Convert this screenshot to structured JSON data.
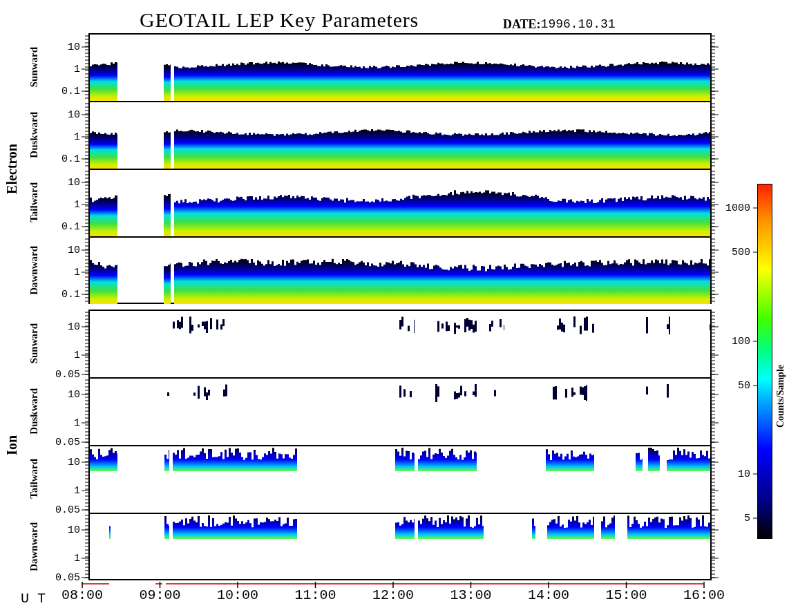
{
  "title": "GEOTAIL LEP Key Parameters",
  "date_label": "DATE:",
  "date": "1996.10.31",
  "groups": [
    {
      "name": "Electron",
      "kind": "electron",
      "panels": [
        {
          "name": "Sunward",
          "yticks": [
            "10",
            "1",
            "0.1"
          ]
        },
        {
          "name": "Duskward",
          "yticks": [
            "10",
            "1",
            "0.1"
          ]
        },
        {
          "name": "Tailward",
          "yticks": [
            "10",
            "1",
            "0.1"
          ]
        },
        {
          "name": "Dawnward",
          "yticks": [
            "10",
            "1",
            "0.1"
          ]
        }
      ]
    },
    {
      "name": "Ion",
      "kind": "ion",
      "panels": [
        {
          "name": "Sunward",
          "yticks": [
            "10",
            "1",
            "0.05"
          ]
        },
        {
          "name": "Duskward",
          "yticks": [
            "10",
            "1",
            "0.05"
          ]
        },
        {
          "name": "Tailward",
          "yticks": [
            "10",
            "1",
            "0.05"
          ]
        },
        {
          "name": "Dawnward",
          "yticks": [
            "10",
            "1",
            "0.05"
          ]
        }
      ]
    }
  ],
  "x_axis": {
    "label": "U T",
    "ticks": [
      "08:00",
      "09:00",
      "10:00",
      "11:00",
      "12:00",
      "13:00",
      "14:00",
      "15:00",
      "16:00"
    ]
  },
  "colorbar": {
    "title": "Counts/Sample",
    "ticks": [
      "1000",
      "500",
      "100",
      "50",
      "10",
      "5"
    ]
  }
}
